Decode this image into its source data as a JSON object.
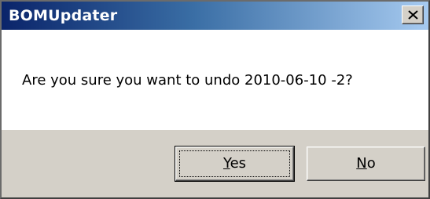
{
  "window": {
    "title": "BOMUpdater",
    "close_icon": "close-x-icon"
  },
  "message": "Are you sure you want to undo 2010-06-10 -2?",
  "buttons": {
    "yes": {
      "mnemonic": "Y",
      "rest": "es"
    },
    "no": {
      "mnemonic": "N",
      "rest": "o"
    }
  },
  "colors": {
    "titlebar_start": "#0a246a",
    "titlebar_end": "#a6caf0",
    "button_face": "#d4d0c8"
  }
}
